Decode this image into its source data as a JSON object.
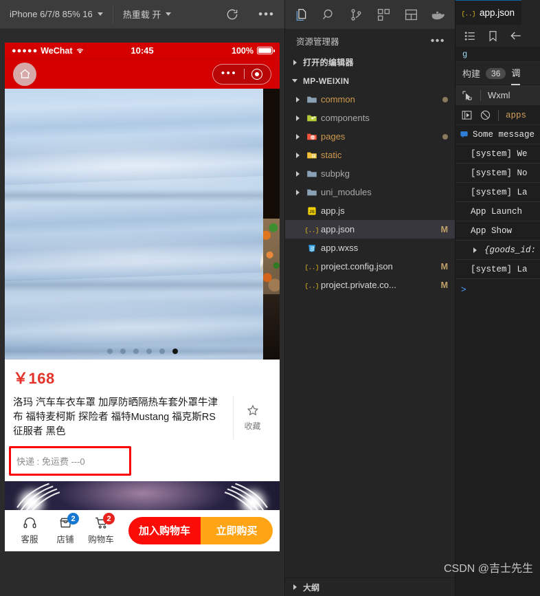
{
  "simulator_toolbar": {
    "device": "iPhone 6/7/8 85% 16",
    "hot_reload": "热重载 开",
    "refresh_icon": "refresh-icon",
    "more_icon": "more-horizontal-icon"
  },
  "phone": {
    "status_bar": {
      "carrier": "WeChat",
      "signal": "●●●●●",
      "time": "10:45",
      "battery_percent": "100%"
    },
    "nav": {
      "home_icon": "home-icon",
      "capsule_more_icon": "capsule-more-icon",
      "capsule_target_icon": "capsule-target-icon"
    },
    "carousel": {
      "total_dots": 6,
      "active_index": 5
    },
    "product": {
      "price": "￥168",
      "title": "洛玛 汽车车衣车罩 加厚防晒隔热车套外罩牛津布 福特麦柯斯 探险者 福特Mustang 福克斯RS 征服者 黑色",
      "favorite_label": "收藏",
      "favorite_icon": "star-outline-icon",
      "shipping": "快递 : 免运费 ---0",
      "highlight_color": "#fa0000",
      "price_color": "#e4322a"
    },
    "actions": {
      "items": [
        {
          "label": "客服",
          "icon": "headset-icon",
          "badge": null,
          "badge_color": null
        },
        {
          "label": "店铺",
          "icon": "shop-icon",
          "badge": "2",
          "badge_color": "#1677d2"
        },
        {
          "label": "购物车",
          "icon": "cart-icon",
          "badge": "2",
          "badge_color": "#e8231f"
        }
      ],
      "add_to_cart": "加入购物车",
      "buy_now": "立即购买",
      "add_to_cart_color": "#fb0c06",
      "buy_now_color": "#ffa415"
    }
  },
  "explorer": {
    "activity_icons": [
      "files-icon",
      "search-icon",
      "source-control-icon",
      "extensions-icon",
      "layout-icon",
      "docker-icon"
    ],
    "title": "资源管理器",
    "more_icon": "more-horizontal-icon",
    "sections": [
      {
        "label": "打开的编辑器",
        "expanded": false
      },
      {
        "label": "MP-WEIXIN",
        "expanded": true
      }
    ],
    "tree": [
      {
        "name": "common",
        "type": "folder",
        "icon": "folder-icon",
        "color": "gold",
        "expandable": true,
        "status": "",
        "dot": true
      },
      {
        "name": "components",
        "type": "folder",
        "icon": "folder-components-icon",
        "color": "gray",
        "expandable": true,
        "status": "",
        "dot": false
      },
      {
        "name": "pages",
        "type": "folder",
        "icon": "folder-pages-icon",
        "color": "gold",
        "expandable": true,
        "status": "",
        "dot": true
      },
      {
        "name": "static",
        "type": "folder",
        "icon": "folder-static-icon",
        "color": "gold",
        "expandable": true,
        "status": "",
        "dot": false
      },
      {
        "name": "subpkg",
        "type": "folder",
        "icon": "folder-icon",
        "color": "gray",
        "expandable": true,
        "status": "",
        "dot": false
      },
      {
        "name": "uni_modules",
        "type": "folder",
        "icon": "folder-icon",
        "color": "gray",
        "expandable": true,
        "status": "",
        "dot": false
      },
      {
        "name": "app.js",
        "type": "file",
        "icon": "js-file-icon",
        "color": "white",
        "expandable": false,
        "status": "",
        "dot": false
      },
      {
        "name": "app.json",
        "type": "file",
        "icon": "json-file-icon",
        "color": "white",
        "expandable": false,
        "status": "M",
        "dot": false,
        "selected": true
      },
      {
        "name": "app.wxss",
        "type": "file",
        "icon": "css-file-icon",
        "color": "white",
        "expandable": false,
        "status": "",
        "dot": false
      },
      {
        "name": "project.config.json",
        "type": "file",
        "icon": "json-file-icon",
        "color": "white",
        "expandable": false,
        "status": "M",
        "dot": false
      },
      {
        "name": "project.private.co...",
        "type": "file",
        "icon": "json-file-icon",
        "color": "white",
        "expandable": false,
        "status": "M",
        "dot": false
      }
    ],
    "outline": {
      "label": "大纲",
      "expanded": false
    }
  },
  "editor": {
    "tab": {
      "label": "app.json",
      "icon": "json-file-icon"
    },
    "tool_icons": [
      "list-icon",
      "bookmark-icon",
      "back-arrow-icon"
    ],
    "code_hint": "g"
  },
  "debugger": {
    "tabs": [
      {
        "label": "构建",
        "badge": "36",
        "selected": false
      },
      {
        "label": "调",
        "badge": "",
        "selected": true
      }
    ],
    "toolbar_row": {
      "select_icon": "cursor-select-icon",
      "label": "Wxml"
    },
    "filter_row": {
      "play_icon": "step-into-icon",
      "clear_icon": "clear-console-icon",
      "text": "apps"
    },
    "logs": [
      {
        "text": "Some message",
        "icon": "message-icon",
        "indent": 0,
        "italic": false
      },
      {
        "text": "[system] We",
        "icon": "",
        "indent": 1,
        "italic": false
      },
      {
        "text": "[system] No",
        "icon": "",
        "indent": 1,
        "italic": false
      },
      {
        "text": "[system] La",
        "icon": "",
        "indent": 1,
        "italic": false
      },
      {
        "text": "App Launch",
        "icon": "",
        "indent": 1,
        "italic": false
      },
      {
        "text": "App Show",
        "icon": "",
        "indent": 1,
        "italic": false
      },
      {
        "text": "{goods_id:",
        "icon": "expand-arrow-icon",
        "indent": 1,
        "italic": true
      },
      {
        "text": "[system] La",
        "icon": "",
        "indent": 1,
        "italic": false
      }
    ],
    "prompt": ">"
  },
  "watermark": "CSDN @吉士先生"
}
